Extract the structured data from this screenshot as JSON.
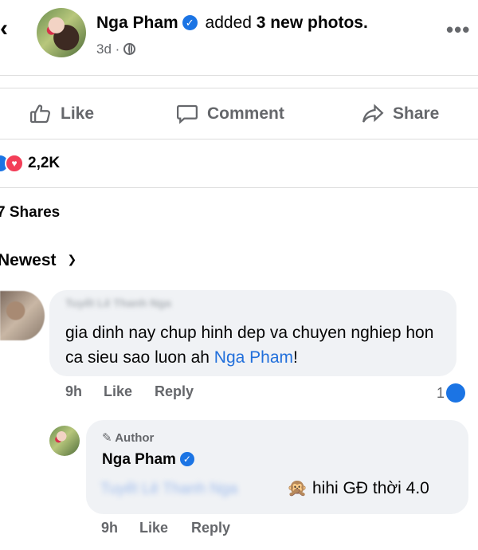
{
  "header": {
    "author": "Nga Pham",
    "action_text": "added",
    "action_bold": "3 new photos.",
    "time": "3d",
    "separator": "·"
  },
  "actions": {
    "like": "Like",
    "comment": "Comment",
    "share": "Share"
  },
  "reactions": {
    "count": "2,2K"
  },
  "shares_text": "7 Shares",
  "sort_label": "Newest",
  "comments": [
    {
      "author_blurred": "Tuyết Lê Thanh Nga",
      "text": "gia dinh nay chup hinh dep va chuyen nghiep hon ca sieu sao luon ah ",
      "mention": "Nga Pham",
      "text_end": "!",
      "time": "9h",
      "like_label": "Like",
      "reply_label": "Reply",
      "like_count": "1"
    }
  ],
  "reply": {
    "badge": "Author",
    "author": "Nga Pham",
    "mention_blurred": "Tuyết Lê Thanh Nga",
    "emoji": "🙊",
    "text": "hihi GĐ thời 4.0",
    "time": "9h",
    "like_label": "Like",
    "reply_label": "Reply"
  },
  "colors": {
    "accent": "#1b74e4",
    "love": "#f33e58",
    "secondary_text": "#65676b",
    "bubble": "#f0f2f5"
  }
}
